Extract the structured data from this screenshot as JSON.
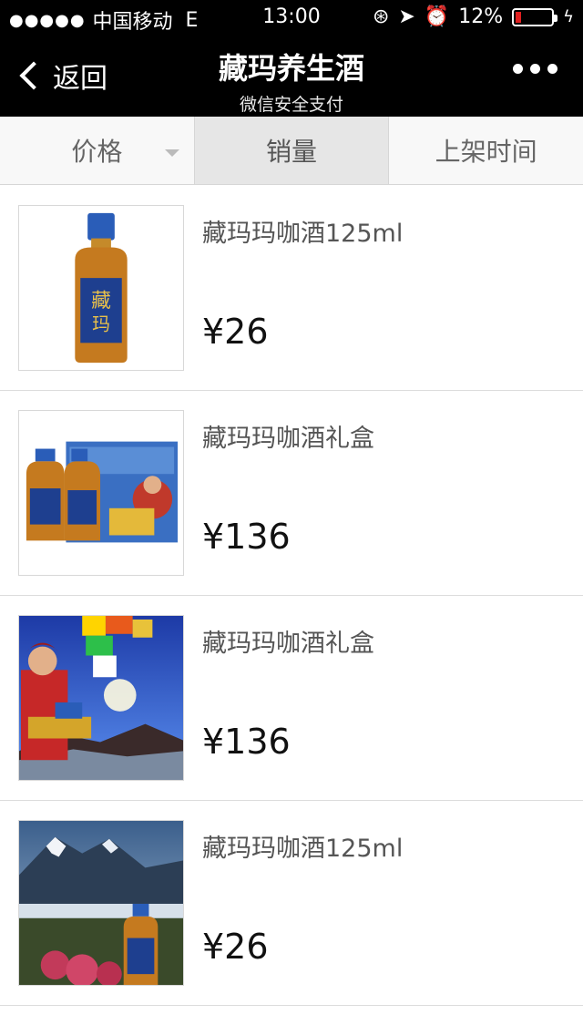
{
  "status": {
    "carrier": "中国移动",
    "network": "E",
    "time": "13:00",
    "battery": "12%"
  },
  "nav": {
    "back_label": "返回",
    "title": "藏玛养生酒",
    "subtitle": "微信安全支付"
  },
  "tabs": [
    {
      "label": "价格"
    },
    {
      "label": "销量"
    },
    {
      "label": "上架时间"
    }
  ],
  "products": [
    {
      "name": "藏玛玛咖酒125ml",
      "price": "¥26",
      "image": "single-bottle"
    },
    {
      "name": "藏玛玛咖酒礼盒",
      "price": "¥136",
      "image": "gift-box"
    },
    {
      "name": "藏玛玛咖酒礼盒",
      "price": "¥136",
      "image": "tibetan-woman-prayer-flags"
    },
    {
      "name": "藏玛玛咖酒125ml",
      "price": "¥26",
      "image": "mountain-bottle"
    }
  ],
  "colors": {
    "navbar": "#000000",
    "active_tab": "#e6e6e6",
    "battery_low": "#e02020"
  }
}
